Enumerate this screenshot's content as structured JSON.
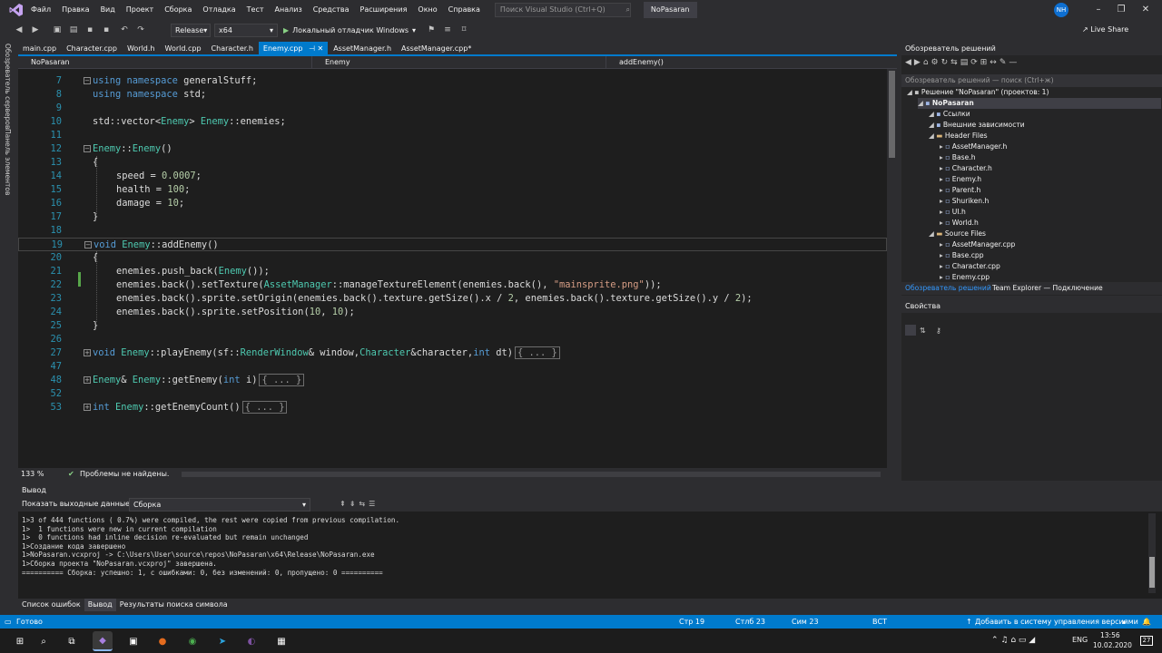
{
  "menu": {
    "items": [
      "Файл",
      "Правка",
      "Вид",
      "Проект",
      "Сборка",
      "Отладка",
      "Тест",
      "Анализ",
      "Средства",
      "Расширения",
      "Окно",
      "Справка"
    ],
    "search_placeholder": "Поиск Visual Studio (Ctrl+Q)",
    "project_name": "NoPasaran",
    "avatar": "NH"
  },
  "toolbar": {
    "config": "Release",
    "platform": "x64",
    "run_label": "Локальный отладчик Windows",
    "live_share": "Live Share"
  },
  "side_panels": [
    "Обозреватель серверов",
    "Панель элементов"
  ],
  "tabs": [
    {
      "label": "main.cpp",
      "active": false
    },
    {
      "label": "Character.cpp",
      "active": false
    },
    {
      "label": "World.h",
      "active": false
    },
    {
      "label": "World.cpp",
      "active": false
    },
    {
      "label": "Character.h",
      "active": false
    },
    {
      "label": "Enemy.cpp",
      "active": true
    },
    {
      "label": "AssetManager.h",
      "active": false
    },
    {
      "label": "AssetManager.cpp*",
      "active": false
    }
  ],
  "navbar": {
    "project": "NoPasaran",
    "class": "Enemy",
    "member": "addEnemy()"
  },
  "code": [
    {
      "n": "7",
      "t": "using namespace generalStuff;"
    },
    {
      "n": "8",
      "t": "using namespace std;"
    },
    {
      "n": "9",
      "t": ""
    },
    {
      "n": "10",
      "t": "std::vector<Enemy> Enemy::enemies;"
    },
    {
      "n": "11",
      "t": ""
    },
    {
      "n": "12",
      "t": "Enemy::Enemy()"
    },
    {
      "n": "13",
      "t": "{"
    },
    {
      "n": "14",
      "t": "speed = 0.0007;"
    },
    {
      "n": "15",
      "t": "health = 100;"
    },
    {
      "n": "16",
      "t": "damage = 10;"
    },
    {
      "n": "17",
      "t": "}"
    },
    {
      "n": "18",
      "t": ""
    },
    {
      "n": "19",
      "t": "void Enemy::addEnemy()"
    },
    {
      "n": "20",
      "t": "{"
    },
    {
      "n": "21",
      "t": "enemies.push_back(Enemy());"
    },
    {
      "n": "22",
      "t": "enemies.back().setTexture(AssetManager::manageTextureElement(enemies.back(), \"mainsprite.png\"));"
    },
    {
      "n": "23",
      "t": "enemies.back().sprite.setOrigin(enemies.back().texture.getSize().x / 2, enemies.back().texture.getSize().y / 2);"
    },
    {
      "n": "24",
      "t": "enemies.back().sprite.setPosition(10, 10);"
    },
    {
      "n": "25",
      "t": "}"
    },
    {
      "n": "26",
      "t": ""
    },
    {
      "n": "27",
      "t": "void Enemy::playEnemy(sf::RenderWindow& window,Character&character,int dt)"
    },
    {
      "n": "47",
      "t": ""
    },
    {
      "n": "48",
      "t": "Enemy& Enemy::getEnemy(int i)"
    },
    {
      "n": "52",
      "t": ""
    },
    {
      "n": "53",
      "t": "int Enemy::getEnemyCount()"
    }
  ],
  "collapsed_label": "{ ... }",
  "editor_status": {
    "zoom": "133 %",
    "problems": "Проблемы не найдены."
  },
  "solution_explorer": {
    "title": "Обозреватель решений",
    "search": "Обозреватель решений — поиск (Ctrl+ж)",
    "items": [
      "Решение \"NoPasaran\" (проектов: 1)",
      "NoPasaran",
      "Ссылки",
      "Внешние зависимости",
      "Header Files",
      "AssetManager.h",
      "Base.h",
      "Character.h",
      "Enemy.h",
      "Parent.h",
      "Shuriken.h",
      "UI.h",
      "World.h",
      "Source Files",
      "AssetManager.cpp",
      "Base.cpp",
      "Character.cpp",
      "Enemy.cpp"
    ],
    "tab_active": "Обозреватель решений",
    "tab_other": "Team Explorer — Подключение"
  },
  "properties": {
    "title": "Свойства"
  },
  "output": {
    "title": "Вывод",
    "source_label": "Показать выходные данные из:",
    "source_value": "Сборка",
    "lines": [
      "1>3 of 444 functions ( 0.7%) were compiled, the rest were copied from previous compilation.",
      "1>  1 functions were new in current compilation",
      "1>  0 functions had inline decision re-evaluated but remain unchanged",
      "1>Создание кода завершено",
      "1>NoPasaran.vcxproj -> C:\\Users\\User\\source\\repos\\NoPasaran\\x64\\Release\\NoPasaran.exe",
      "1>Сборка проекта \"NoPasaran.vcxproj\" завершена.",
      "========== Сборка: успешно: 1, с ошибками: 0, без изменений: 0, пропущено: 0 =========="
    ]
  },
  "bottom_tabs": [
    {
      "label": "Список ошибок",
      "active": false
    },
    {
      "label": "Вывод",
      "active": true
    },
    {
      "label": "Результаты поиска символа",
      "active": false
    }
  ],
  "status": {
    "ready": "Готово",
    "line": "Стр 19",
    "col": "Стлб 23",
    "ch": "Сим 23",
    "ins": "ВСТ",
    "vcs": "Добавить в систему управления версиями"
  },
  "taskbar": {
    "lang": "ENG",
    "time": "13:56",
    "date": "10.02.2020",
    "notifications": "27"
  },
  "colors": {
    "accent": "#007acc",
    "editor_bg": "#1e1e1e",
    "chrome": "#2d2d30"
  }
}
